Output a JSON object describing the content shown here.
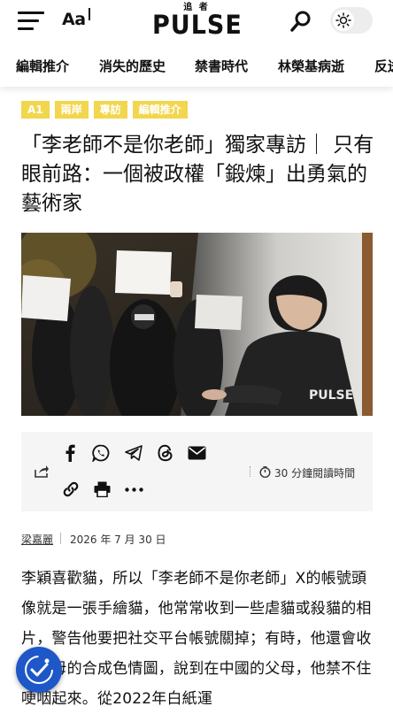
{
  "header": {
    "font_size_label": "Aa",
    "logo_small": "追 者",
    "logo_text": "PULSE"
  },
  "nav": {
    "items": [
      "編輯推介",
      "消失的歷史",
      "禁書時代",
      "林榮基病逝",
      "反送"
    ]
  },
  "article": {
    "tags": [
      "A1",
      "兩岸",
      "專訪",
      "編輯推介"
    ],
    "headline": "「李老師不是你老師」獨家專訪｜ 只有眼前路：一個被政權「鍛煉」出勇氣的藝術家",
    "hero_watermark": "PULSE",
    "read_time": "30 分鐘閱讀時間",
    "author": "梁嘉麗",
    "date": "2026 年 7 月 30 日",
    "body": "李穎喜歡貓，所以「李老師不是你老師」X的帳號頭像就是一張手繪貓，他常常收到一些虐貓或殺貓的相片，警告他要把社交平台帳號關掉；有時，他還會收到父母的合成色情圖，說到在中國的父母，他禁不住哽咽起來。從2022年白紙運"
  },
  "share": {
    "icons": [
      "facebook-icon",
      "whatsapp-icon",
      "telegram-icon",
      "threads-icon",
      "email-icon",
      "link-icon",
      "print-icon",
      "more-icon"
    ]
  },
  "colors": {
    "tag_bg": "#f2d64e",
    "a11y_bg": "#1e57c8",
    "share_bg": "#f5f5f5"
  }
}
